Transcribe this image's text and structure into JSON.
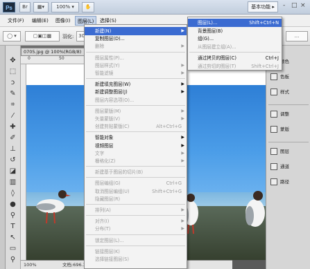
{
  "app_bar": {
    "logo": "Ps",
    "zoom": "100%",
    "workspace": "基本功能",
    "window_controls": [
      "-",
      "□",
      "×"
    ]
  },
  "menu_bar": [
    "文件(F)",
    "编辑(E)",
    "图像(I)",
    "图层(L)",
    "选择(S)"
  ],
  "options_bar": {
    "feather_label": "羽化:",
    "feather_value": "30 px",
    "right_label": "..."
  },
  "document": {
    "tab": "0705.jpg @ 100%(RGB/8) ×",
    "status_zoom": "100%",
    "status_doc": "文档:696.3K/696"
  },
  "ruler_numbers": [
    "0",
    "50",
    "100",
    "150",
    "200",
    "250",
    "300"
  ],
  "layer_submenu": [
    {
      "label": "新建(N)",
      "highlight": true,
      "arrow": true
    },
    {
      "label": "复制图层(D)..."
    },
    {
      "label": "删除",
      "disabled": true,
      "arrow": true
    },
    {
      "sep": true
    },
    {
      "label": "图层属性(P)...",
      "disabled": true
    },
    {
      "label": "图层样式(Y)",
      "disabled": true,
      "arrow": true
    },
    {
      "label": "智能滤镜",
      "disabled": true,
      "arrow": true
    },
    {
      "sep": true
    },
    {
      "label": "新建填充图层(W)",
      "arrow": true
    },
    {
      "label": "新建调整图层(J)",
      "arrow": true
    },
    {
      "label": "图层内容选项(O)...",
      "disabled": true
    },
    {
      "sep": true
    },
    {
      "label": "图层蒙版(M)",
      "disabled": true,
      "arrow": true
    },
    {
      "label": "矢量蒙版(V)",
      "disabled": true,
      "arrow": true
    },
    {
      "label": "创建剪贴蒙版(C)",
      "disabled": true,
      "shortcut": "Alt+Ctrl+G"
    },
    {
      "sep": true
    },
    {
      "label": "智能对象",
      "arrow": true
    },
    {
      "label": "视频图层",
      "arrow": true
    },
    {
      "label": "文字",
      "disabled": true,
      "arrow": true
    },
    {
      "label": "栅格化(Z)",
      "disabled": true,
      "arrow": true
    },
    {
      "sep": true
    },
    {
      "label": "新建基于图层的切片(B)",
      "disabled": true
    },
    {
      "sep": true
    },
    {
      "label": "图层编组(G)",
      "disabled": true,
      "shortcut": "Ctrl+G"
    },
    {
      "label": "取消图层编组(U)",
      "disabled": true,
      "shortcut": "Shift+Ctrl+G"
    },
    {
      "label": "隐藏图层(R)",
      "disabled": true
    },
    {
      "sep": true
    },
    {
      "label": "排列(A)",
      "disabled": true,
      "arrow": true
    },
    {
      "sep": true
    },
    {
      "label": "对齐(I)",
      "disabled": true,
      "arrow": true
    },
    {
      "label": "分布(T)",
      "disabled": true,
      "arrow": true
    },
    {
      "sep": true
    },
    {
      "label": "锁定图层(L)...",
      "disabled": true
    },
    {
      "sep": true
    },
    {
      "label": "链接图层(K)",
      "disabled": true
    },
    {
      "label": "选择链接图层(S)",
      "disabled": true
    }
  ],
  "new_submenu": [
    {
      "label": "图层(L)...",
      "shortcut": "Shift+Ctrl+N",
      "highlight": true
    },
    {
      "label": "背景图层(B)"
    },
    {
      "label": "组(G)..."
    },
    {
      "label": "从图层建立组(A)...",
      "disabled": true
    },
    {
      "sep": true
    },
    {
      "label": "通过拷贝的图层(C)",
      "shortcut": "Ctrl+J"
    },
    {
      "label": "通过剪切的图层(T)",
      "shortcut": "Shift+Ctrl+J",
      "disabled": true
    }
  ],
  "panels": [
    {
      "label": "颜色"
    },
    {
      "label": "色板"
    },
    {
      "label": "样式"
    },
    {
      "sep": true
    },
    {
      "label": "调整"
    },
    {
      "label": "蒙版"
    },
    {
      "sep": true
    },
    {
      "label": "图层"
    },
    {
      "label": "通道"
    },
    {
      "label": "路径"
    }
  ]
}
